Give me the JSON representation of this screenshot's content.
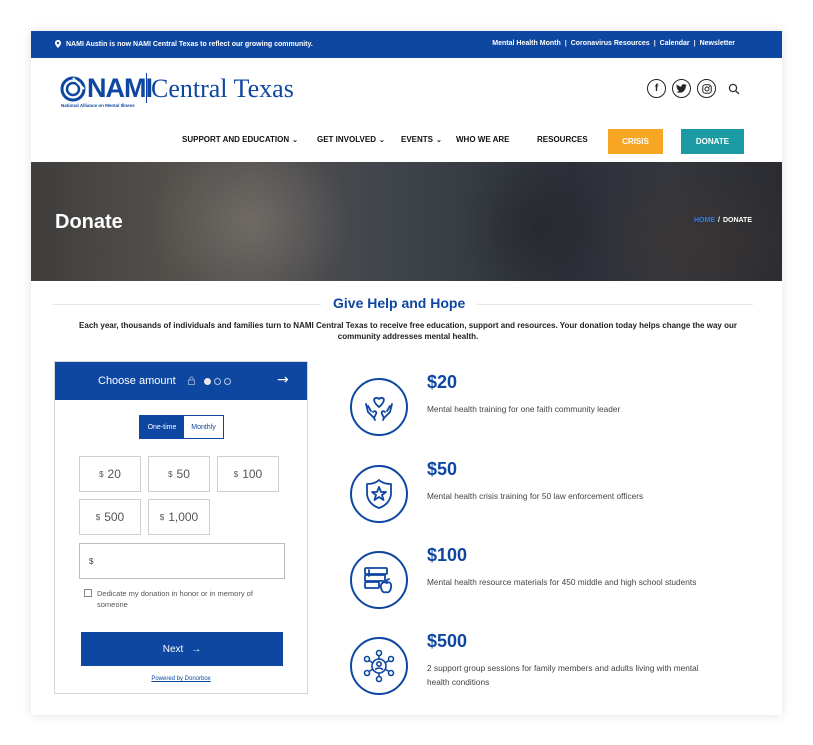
{
  "topbar": {
    "notice": "NAMI Austin is now NAMI Central Texas to reflect our growing community.",
    "links": [
      "Mental Health Month",
      "Coronavirus Resources",
      "Calendar",
      "Newsletter"
    ],
    "separator": "|"
  },
  "logo": {
    "mark": "NAMI",
    "name": "Central Texas",
    "tagline": "National Alliance on Mental Illness"
  },
  "social": {
    "facebook": "f",
    "twitter": "t",
    "instagram": "◎",
    "icons": [
      "facebook-icon",
      "twitter-icon",
      "instagram-icon",
      "search-icon"
    ]
  },
  "nav": {
    "items": [
      {
        "label": "SUPPORT AND EDUCATION",
        "chevron": "⌄"
      },
      {
        "label": "GET INVOLVED",
        "chevron": "⌄"
      },
      {
        "label": "EVENTS",
        "chevron": "⌄"
      },
      {
        "label": "WHO WE ARE",
        "chevron": ""
      },
      {
        "label": "RESOURCES",
        "chevron": ""
      }
    ],
    "crisis": "CRISIS",
    "donate": "DONATE"
  },
  "hero": {
    "title": "Donate",
    "breadcrumb_home": "HOME",
    "breadcrumb_sep": "/",
    "breadcrumb_current": "DONATE"
  },
  "section": {
    "title": "Give Help and Hope",
    "intro": "Each year, thousands of individuals and families turn to NAMI Central Texas to receive free education, support and resources. Your donation today helps change the way our community addresses mental health."
  },
  "widget": {
    "header": "Choose amount",
    "step": "1 of 3",
    "arrow": "→",
    "frequency": {
      "one_time": "One-time",
      "monthly": "Monthly",
      "selected": "One-time"
    },
    "currency": "$",
    "amounts": [
      "20",
      "50",
      "100",
      "500",
      "1,000"
    ],
    "custom_prefix": "$",
    "dedicate_label": "Dedicate my donation in honor or in memory of someone",
    "next_label": "Next",
    "next_arrow": "→",
    "powered_by": "Powered by Donorbox"
  },
  "impacts": [
    {
      "amount": "$20",
      "text": "Mental health training for one faith community leader",
      "icon": "hands-heart-icon"
    },
    {
      "amount": "$50",
      "text": "Mental health crisis training for 50 law enforcement officers",
      "icon": "police-badge-icon"
    },
    {
      "amount": "$100",
      "text": "Mental health resource materials for 450 middle and high school students",
      "icon": "books-apple-icon"
    },
    {
      "amount": "$500",
      "text": "2 support group sessions for family members and adults living with mental health conditions",
      "icon": "support-group-icon"
    }
  ],
  "colors": {
    "brand_blue": "#0d47a1",
    "crisis_orange": "#f6a623",
    "donate_teal": "#1b9aa3",
    "breadcrumb_link": "#2d7be5"
  }
}
